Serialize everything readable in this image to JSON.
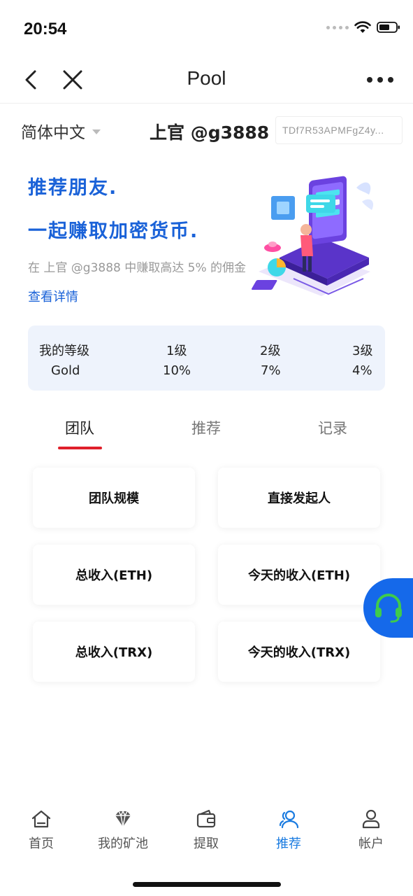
{
  "status_bar": {
    "time": "20:54"
  },
  "nav": {
    "title": "Pool"
  },
  "header": {
    "language": "简体中文",
    "user": "上官 @g3888",
    "address": "TDf7R53APMFgZ4y..."
  },
  "hero": {
    "title_line1": "推荐朋友.",
    "title_line2": "一起赚取加密货币.",
    "description": "在 上官 @g3888 中赚取高达 5% 的佣金",
    "details_link": "查看详情"
  },
  "levels": {
    "headers": [
      "我的等级",
      "1级",
      "2级",
      "3级"
    ],
    "values": [
      "Gold",
      "10%",
      "7%",
      "4%"
    ]
  },
  "tabs": [
    {
      "label": "团队",
      "active": true
    },
    {
      "label": "推荐",
      "active": false
    },
    {
      "label": "记录",
      "active": false
    }
  ],
  "cards": [
    {
      "label": "团队规模"
    },
    {
      "label": "直接发起人"
    },
    {
      "label": "总收入(ETH)"
    },
    {
      "label": "今天的收入(ETH)"
    },
    {
      "label": "总收入(TRX)"
    },
    {
      "label": "今天的收入(TRX)"
    }
  ],
  "bottom_nav": [
    {
      "label": "首页",
      "icon": "home-icon",
      "active": false
    },
    {
      "label": "我的矿池",
      "icon": "diamond-icon",
      "active": false
    },
    {
      "label": "提取",
      "icon": "wallet-icon",
      "active": false
    },
    {
      "label": "推荐",
      "icon": "users-icon",
      "active": true
    },
    {
      "label": "帐户",
      "icon": "user-icon",
      "active": false
    }
  ],
  "colors": {
    "accent_blue": "#1a62d8",
    "tab_indicator": "#e0202b",
    "active_nav": "#1a7be0",
    "support_button": "#1569ea",
    "headset": "#3fcb4c",
    "level_card_bg": "#eef3fc"
  }
}
